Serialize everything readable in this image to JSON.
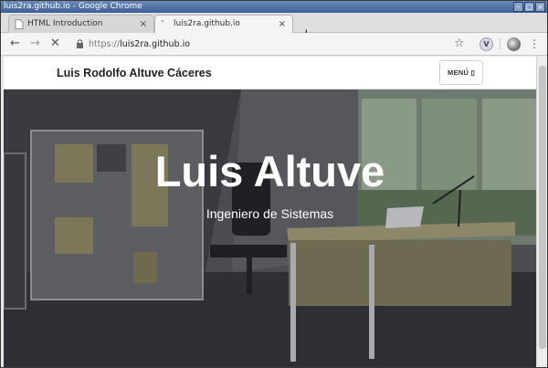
{
  "window": {
    "title": "luis2ra.github.io - Google Chrome",
    "controls": [
      "–",
      "□",
      "×"
    ]
  },
  "tabs": [
    {
      "label": "HTML Introduction",
      "active": false
    },
    {
      "label": "luis2ra.github.io",
      "active": true
    }
  ],
  "tab_close_glyph": "×",
  "new_tab_glyph": "+",
  "toolbar": {
    "back_glyph": "←",
    "forward_glyph": "→",
    "stop_glyph": "✕",
    "url_scheme": "https://",
    "url_host": "luis2ra.github.io",
    "star_glyph": "☆",
    "extension_label": "V",
    "menu_glyph": "⋮"
  },
  "site": {
    "brand": "Luis Rodolfo Altuve Cáceres",
    "menu_label": "MENÚ ▯",
    "hero_title": "Luis Altuve",
    "hero_subtitle": "Ingeniero de Sistemas"
  },
  "colors": {
    "titlebar": "#3c5f97",
    "hero_overlay": "#3d3f44"
  }
}
